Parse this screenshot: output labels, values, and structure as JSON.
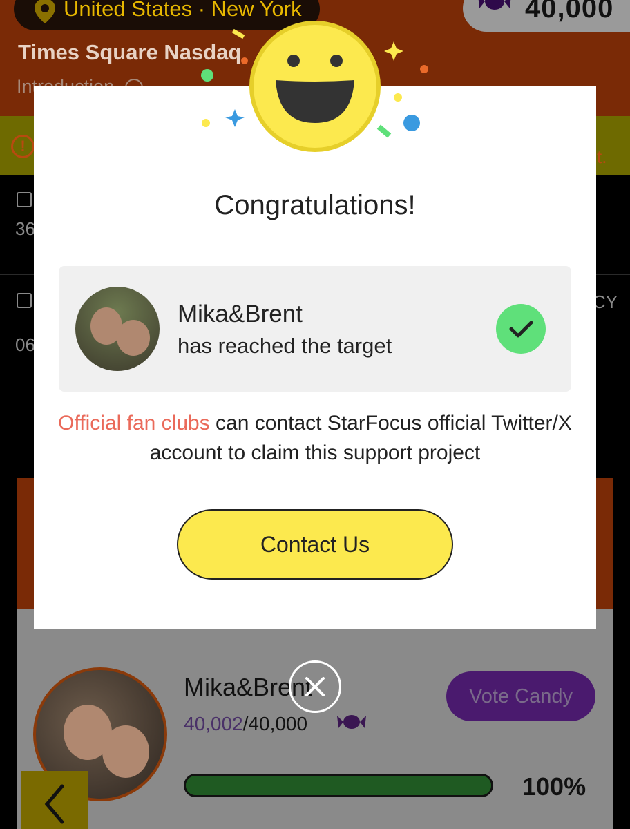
{
  "header": {
    "location": "United States · New York",
    "candy_count": "40,000",
    "title": "Times Square Nasdaq",
    "introduction": "Introduction"
  },
  "notice": {
    "tail": "t."
  },
  "info_rows": [
    {
      "value": "36",
      "tail": ""
    },
    {
      "value": "06",
      "tail": "CY"
    }
  ],
  "modal": {
    "title": "Congratulations!",
    "artist_name": "Mika&Brent",
    "status": "has reached the target",
    "message_highlight": "Official fan clubs",
    "message_rest": " can contact StarFocus official Twitter/X account to claim this support project",
    "contact_button": "Contact Us"
  },
  "card": {
    "name": "Mika&Brent",
    "votes_current": "40,002",
    "votes_goal": "/40,000",
    "vote_button": "Vote Candy",
    "progress_label": "100%",
    "progress_fraction": 1.0
  },
  "colors": {
    "accent_yellow": "#fce94e",
    "highlight_red": "#ea6a5a",
    "success_green": "#5fe07a",
    "brand_orange": "#7a2a06"
  }
}
